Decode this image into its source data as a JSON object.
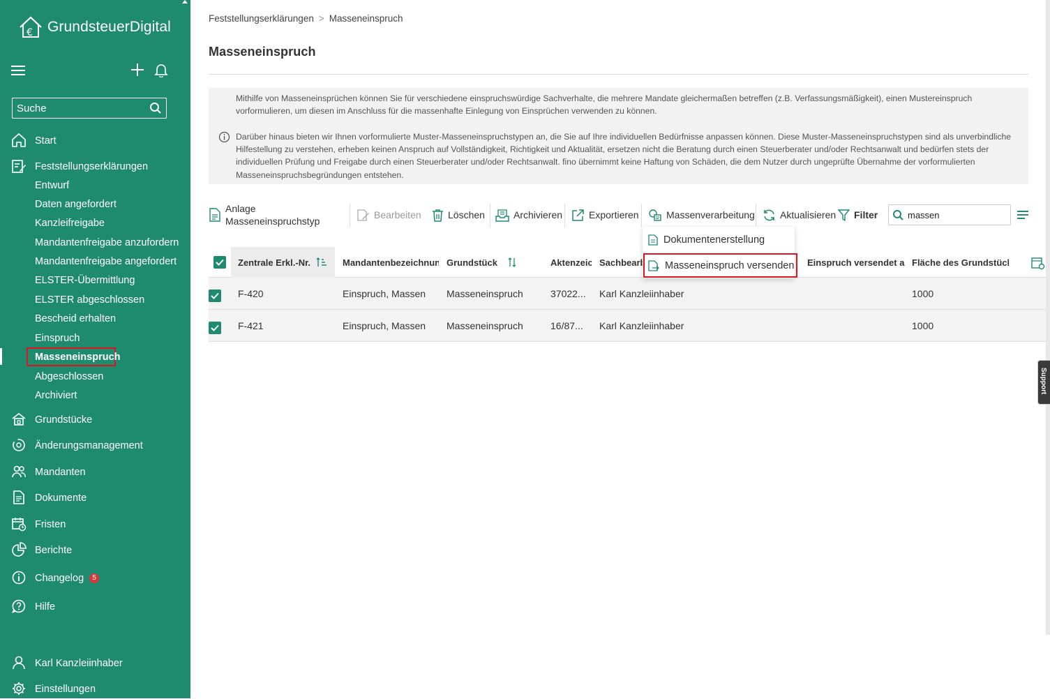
{
  "app": {
    "name": "GrundsteuerDigital"
  },
  "sidebar": {
    "search_placeholder": "Suche",
    "items": [
      {
        "label": "Start",
        "icon": "home-icon"
      },
      {
        "label": "Feststellungserklärungen",
        "icon": "form-edit-icon"
      },
      {
        "label": "Entwurf"
      },
      {
        "label": "Daten angefordert"
      },
      {
        "label": "Kanzleifreigabe"
      },
      {
        "label": "Mandantenfreigabe anzufordern"
      },
      {
        "label": "Mandantenfreigabe angefordert"
      },
      {
        "label": "ELSTER-Übermittlung"
      },
      {
        "label": "ELSTER abgeschlossen"
      },
      {
        "label": "Bescheid erhalten"
      },
      {
        "label": "Einspruch"
      },
      {
        "label": "Masseneinspruch",
        "active": true
      },
      {
        "label": "Abgeschlossen"
      },
      {
        "label": "Archiviert"
      },
      {
        "label": "Grundstücke",
        "icon": "property-icon"
      },
      {
        "label": "Änderungsmanagement",
        "icon": "change-management-icon"
      },
      {
        "label": "Mandanten",
        "icon": "clients-icon"
      },
      {
        "label": "Dokumente",
        "icon": "document-icon"
      },
      {
        "label": "Fristen",
        "icon": "calendar-icon"
      },
      {
        "label": "Berichte",
        "icon": "pie-chart-icon"
      },
      {
        "label": "Changelog",
        "icon": "info-icon",
        "badge": "5"
      },
      {
        "label": "Hilfe",
        "icon": "help-icon"
      }
    ],
    "user": "Karl Kanzleiinhaber",
    "settings": "Einstellungen"
  },
  "breadcrumb": {
    "parent": "Feststellungserklärungen",
    "separator": ">",
    "current": "Masseneinspruch"
  },
  "page": {
    "title": "Masseneinspruch",
    "info_paragraph_1": "Mithilfe von Masseneinsprüchen können Sie für verschiedene einspruchswürdige Sachverhalte, die mehrere Mandate gleichermaßen betreffen (z.B. Verfassungsmäßigkeit), einen Mustereinspruch vorformulieren, um diesen im Anschluss für die massenhafte Einlegung von Einsprüchen verwenden zu können.",
    "info_paragraph_2": "Darüber hinaus bieten wir Ihnen vorformulierte Muster-Masseneinspruchstypen an, die Sie auf Ihre individuellen Bedürfnisse anpassen können. Diese Muster-Masseneinspruchstypen sind als unverbindliche Hilfestellung zu verstehen, erheben keinen Anspruch auf Vollständigkeit, Richtigkeit und Aktualität, ersetzen nicht die Beratung durch einen Steuerberater und/oder Rechtsanwalt und bedürfen stets der individuellen Prüfung und Freigabe durch einen Steuerberater und/oder Rechtsanwalt. fino übernimmt keine Haftung von Schäden, die dem Nutzer durch ungeprüfte Übernahme der vorformulierten Masseneinspruchsbegründungen entstehen."
  },
  "toolbar": {
    "anlage_line1": "Anlage",
    "anlage_line2": "Masseneinspruchstyp",
    "bearbeiten": "Bearbeiten",
    "loeschen": "Löschen",
    "archivieren": "Archivieren",
    "exportieren": "Exportieren",
    "massenverarbeitung": "Massenverarbeitung",
    "aktualisieren": "Aktualisieren",
    "filter": "Filter",
    "search_value": "massen"
  },
  "dropdown": {
    "items": [
      "Dokumentenerstellung",
      "Masseneinspruch versenden"
    ]
  },
  "table": {
    "columns": [
      "Zentrale Erkl.-Nr.",
      "Mandantenbezeichnung",
      "Grundstück",
      "Aktenzeichen",
      "Sachbearbeiter",
      "Einspruch versendet am",
      "Fläche des Grundstücks"
    ],
    "rows": [
      {
        "nr": "F-420",
        "mandant": "Einspruch, Massen",
        "grundstueck": "Masseneinspruch",
        "aktenzeichen": "37022...",
        "sachbearbeiter": "Karl Kanzleiinhaber",
        "versendet": "",
        "flaeche": "1000"
      },
      {
        "nr": "F-421",
        "mandant": "Einspruch, Massen",
        "grundstueck": "Masseneinspruch",
        "aktenzeichen": "16/87...",
        "sachbearbeiter": "Karl Kanzleiinhaber",
        "versendet": "",
        "flaeche": "1000"
      }
    ]
  },
  "support_tab": "Support",
  "colors": {
    "brand": "#1e8a6e",
    "highlight": "#e0141e",
    "badge": "#d9363e"
  }
}
